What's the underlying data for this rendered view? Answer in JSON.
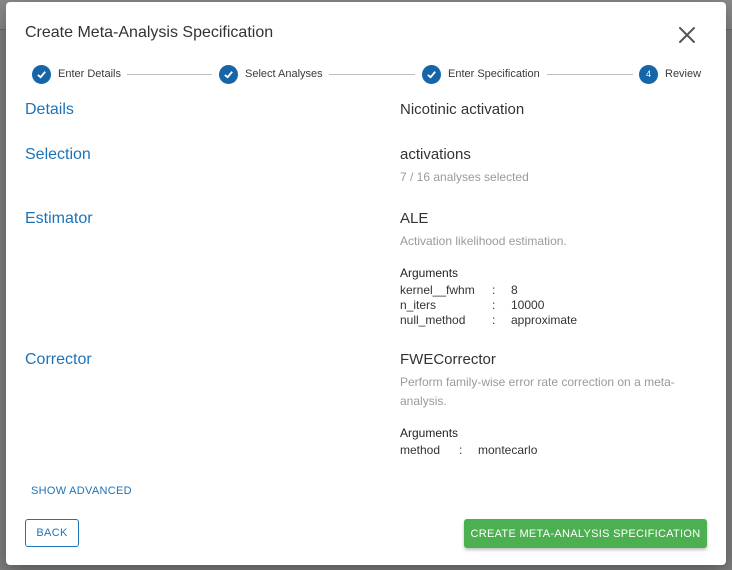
{
  "dialog": {
    "title": "Create Meta-Analysis Specification"
  },
  "stepper": {
    "steps": [
      {
        "label": "Enter Details",
        "state": "complete"
      },
      {
        "label": "Select Analyses",
        "state": "complete"
      },
      {
        "label": "Enter Specification",
        "state": "complete"
      },
      {
        "label": "Review",
        "number": "4",
        "state": "active"
      }
    ]
  },
  "details": {
    "title": "Details",
    "value": "Nicotinic activation"
  },
  "selection": {
    "title": "Selection",
    "value": "activations",
    "summary": "7 / 16 analyses selected"
  },
  "estimator": {
    "title": "Estimator",
    "value": "ALE",
    "description": "Activation likelihood estimation.",
    "arguments_label": "Arguments",
    "arguments": [
      {
        "key": "kernel__fwhm",
        "sep": ":",
        "value": "8"
      },
      {
        "key": "n_iters",
        "sep": ":",
        "value": "10000"
      },
      {
        "key": "null_method",
        "sep": ":",
        "value": "approximate"
      }
    ]
  },
  "corrector": {
    "title": "Corrector",
    "value": "FWECorrector",
    "description": "Perform family-wise error rate correction on a meta-analysis.",
    "arguments_label": "Arguments",
    "arguments": [
      {
        "key": "method",
        "sep": ":",
        "value": "montecarlo"
      }
    ]
  },
  "actions": {
    "show_advanced": "SHOW ADVANCED",
    "back": "BACK",
    "create": "CREATE META-ANALYSIS SPECIFICATION"
  },
  "colors": {
    "primary": "#1e73b8",
    "stepper": "#1565a8",
    "success": "#4caf50"
  }
}
